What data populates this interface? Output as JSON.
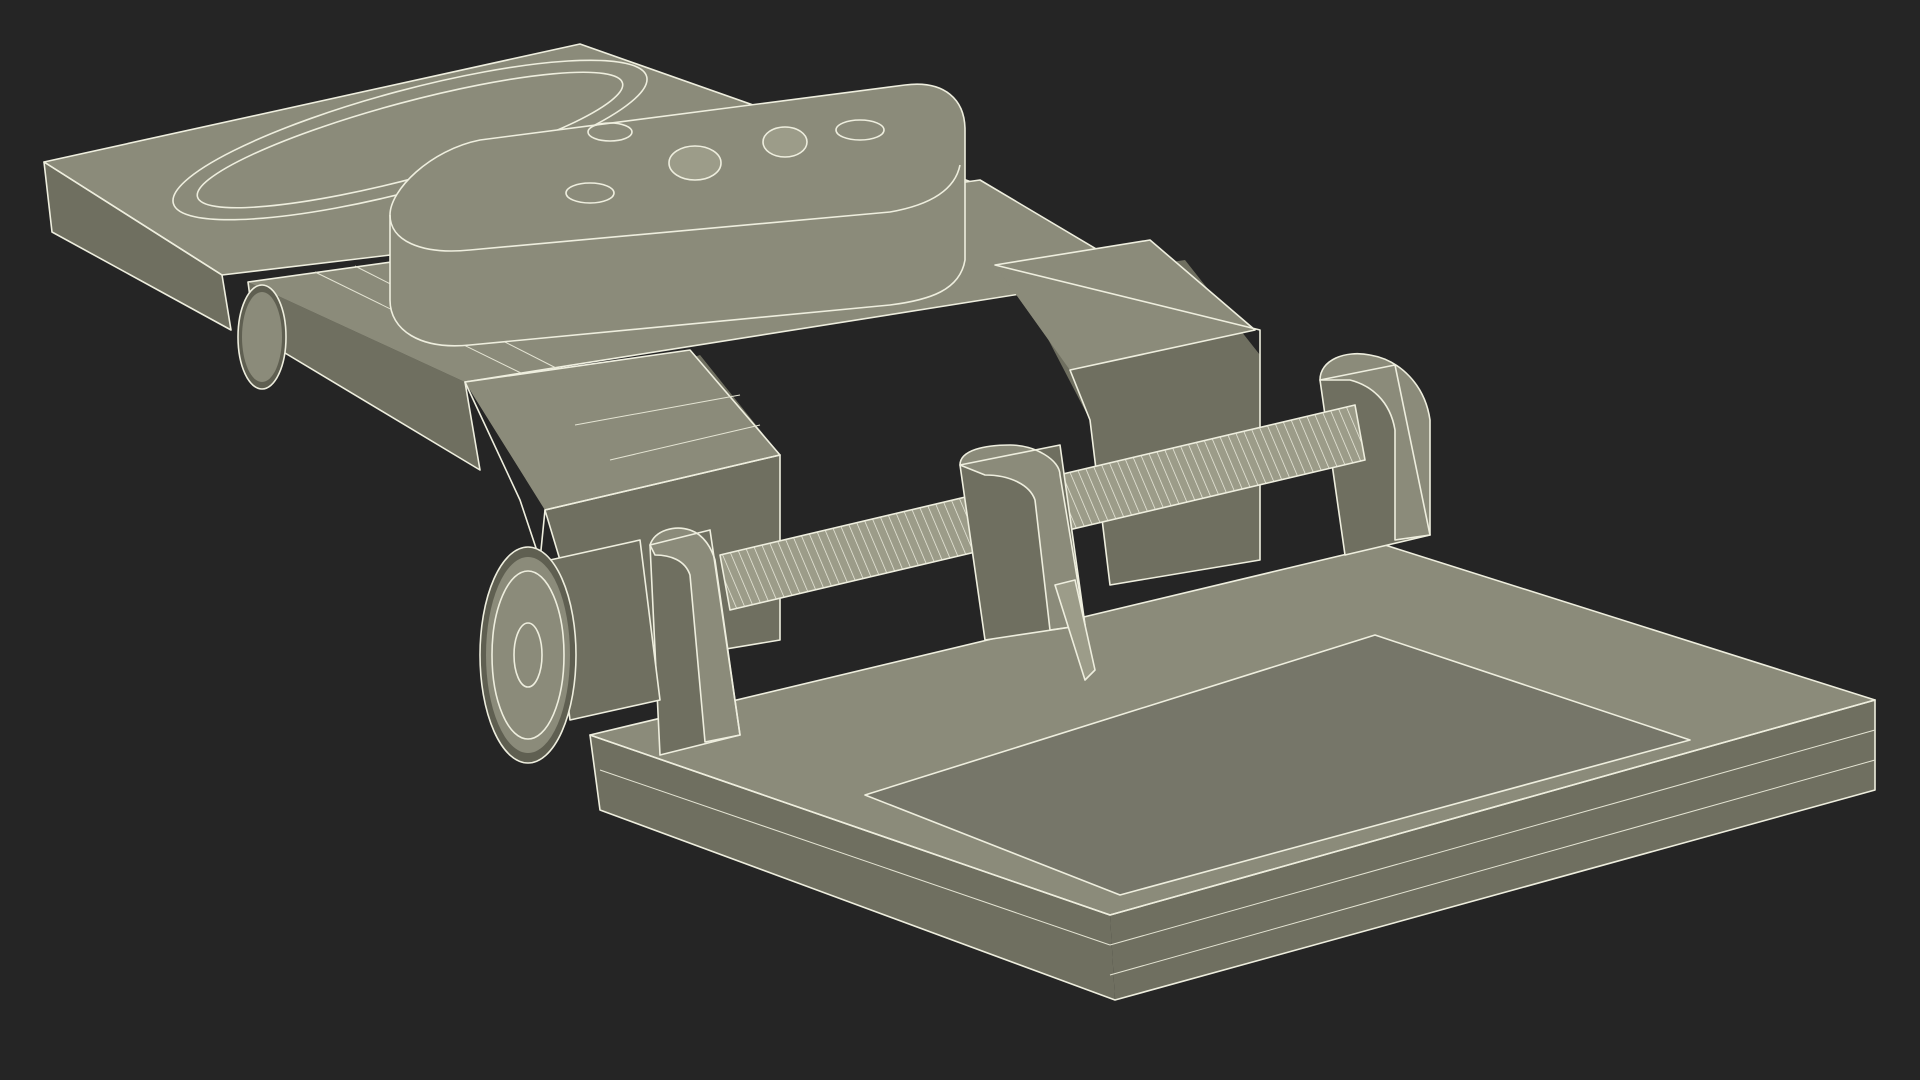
{
  "scene": {
    "subject": "wireframe-3d-model",
    "colors": {
      "background": "#252525",
      "surface": "#8b8b7a",
      "wire": "#eeeede"
    }
  }
}
